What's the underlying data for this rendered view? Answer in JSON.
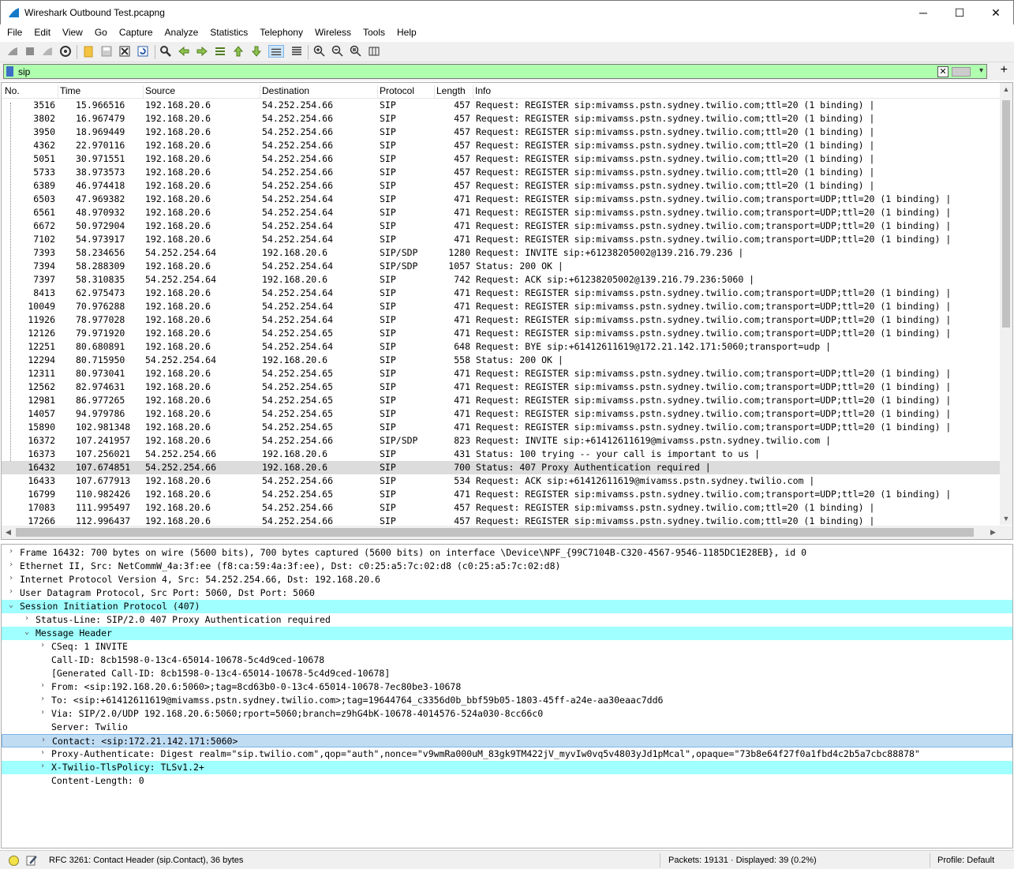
{
  "window": {
    "title": "Wireshark Outbound Test.pcapng",
    "minimize": "─",
    "maximize": "☐",
    "close": "✕"
  },
  "menu": [
    "File",
    "Edit",
    "View",
    "Go",
    "Capture",
    "Analyze",
    "Statistics",
    "Telephony",
    "Wireless",
    "Tools",
    "Help"
  ],
  "filter": {
    "value": "sip",
    "clear": "✕",
    "dropdown": "▾",
    "add": "+"
  },
  "columns": {
    "no": "No.",
    "time": "Time",
    "source": "Source",
    "destination": "Destination",
    "protocol": "Protocol",
    "length": "Length",
    "info": "Info"
  },
  "packets": [
    {
      "no": "3516",
      "time": "15.966516",
      "src": "192.168.20.6",
      "dst": "54.252.254.66",
      "proto": "SIP",
      "len": "457",
      "info": "Request: REGISTER sip:mivamss.pstn.sydney.twilio.com;ttl=20  (1 binding) |"
    },
    {
      "no": "3802",
      "time": "16.967479",
      "src": "192.168.20.6",
      "dst": "54.252.254.66",
      "proto": "SIP",
      "len": "457",
      "info": "Request: REGISTER sip:mivamss.pstn.sydney.twilio.com;ttl=20  (1 binding) |"
    },
    {
      "no": "3950",
      "time": "18.969449",
      "src": "192.168.20.6",
      "dst": "54.252.254.66",
      "proto": "SIP",
      "len": "457",
      "info": "Request: REGISTER sip:mivamss.pstn.sydney.twilio.com;ttl=20  (1 binding) |"
    },
    {
      "no": "4362",
      "time": "22.970116",
      "src": "192.168.20.6",
      "dst": "54.252.254.66",
      "proto": "SIP",
      "len": "457",
      "info": "Request: REGISTER sip:mivamss.pstn.sydney.twilio.com;ttl=20  (1 binding) |"
    },
    {
      "no": "5051",
      "time": "30.971551",
      "src": "192.168.20.6",
      "dst": "54.252.254.66",
      "proto": "SIP",
      "len": "457",
      "info": "Request: REGISTER sip:mivamss.pstn.sydney.twilio.com;ttl=20  (1 binding) |"
    },
    {
      "no": "5733",
      "time": "38.973573",
      "src": "192.168.20.6",
      "dst": "54.252.254.66",
      "proto": "SIP",
      "len": "457",
      "info": "Request: REGISTER sip:mivamss.pstn.sydney.twilio.com;ttl=20  (1 binding) |"
    },
    {
      "no": "6389",
      "time": "46.974418",
      "src": "192.168.20.6",
      "dst": "54.252.254.66",
      "proto": "SIP",
      "len": "457",
      "info": "Request: REGISTER sip:mivamss.pstn.sydney.twilio.com;ttl=20  (1 binding) |"
    },
    {
      "no": "6503",
      "time": "47.969382",
      "src": "192.168.20.6",
      "dst": "54.252.254.64",
      "proto": "SIP",
      "len": "471",
      "info": "Request: REGISTER sip:mivamss.pstn.sydney.twilio.com;transport=UDP;ttl=20  (1 binding) |"
    },
    {
      "no": "6561",
      "time": "48.970932",
      "src": "192.168.20.6",
      "dst": "54.252.254.64",
      "proto": "SIP",
      "len": "471",
      "info": "Request: REGISTER sip:mivamss.pstn.sydney.twilio.com;transport=UDP;ttl=20  (1 binding) |"
    },
    {
      "no": "6672",
      "time": "50.972904",
      "src": "192.168.20.6",
      "dst": "54.252.254.64",
      "proto": "SIP",
      "len": "471",
      "info": "Request: REGISTER sip:mivamss.pstn.sydney.twilio.com;transport=UDP;ttl=20  (1 binding) |"
    },
    {
      "no": "7102",
      "time": "54.973917",
      "src": "192.168.20.6",
      "dst": "54.252.254.64",
      "proto": "SIP",
      "len": "471",
      "info": "Request: REGISTER sip:mivamss.pstn.sydney.twilio.com;transport=UDP;ttl=20  (1 binding) |"
    },
    {
      "no": "7393",
      "time": "58.234656",
      "src": "54.252.254.64",
      "dst": "192.168.20.6",
      "proto": "SIP/SDP",
      "len": "1280",
      "info": "Request: INVITE sip:+61238205002@139.216.79.236 |"
    },
    {
      "no": "7394",
      "time": "58.288309",
      "src": "192.168.20.6",
      "dst": "54.252.254.64",
      "proto": "SIP/SDP",
      "len": "1057",
      "info": "Status: 200 OK |"
    },
    {
      "no": "7397",
      "time": "58.310835",
      "src": "54.252.254.64",
      "dst": "192.168.20.6",
      "proto": "SIP",
      "len": "742",
      "info": "Request: ACK sip:+61238205002@139.216.79.236:5060 |"
    },
    {
      "no": "8413",
      "time": "62.975473",
      "src": "192.168.20.6",
      "dst": "54.252.254.64",
      "proto": "SIP",
      "len": "471",
      "info": "Request: REGISTER sip:mivamss.pstn.sydney.twilio.com;transport=UDP;ttl=20  (1 binding) |"
    },
    {
      "no": "10049",
      "time": "70.976288",
      "src": "192.168.20.6",
      "dst": "54.252.254.64",
      "proto": "SIP",
      "len": "471",
      "info": "Request: REGISTER sip:mivamss.pstn.sydney.twilio.com;transport=UDP;ttl=20  (1 binding) |"
    },
    {
      "no": "11926",
      "time": "78.977028",
      "src": "192.168.20.6",
      "dst": "54.252.254.64",
      "proto": "SIP",
      "len": "471",
      "info": "Request: REGISTER sip:mivamss.pstn.sydney.twilio.com;transport=UDP;ttl=20  (1 binding) |"
    },
    {
      "no": "12126",
      "time": "79.971920",
      "src": "192.168.20.6",
      "dst": "54.252.254.65",
      "proto": "SIP",
      "len": "471",
      "info": "Request: REGISTER sip:mivamss.pstn.sydney.twilio.com;transport=UDP;ttl=20  (1 binding) |"
    },
    {
      "no": "12251",
      "time": "80.680891",
      "src": "192.168.20.6",
      "dst": "54.252.254.64",
      "proto": "SIP",
      "len": "648",
      "info": "Request: BYE sip:+61412611619@172.21.142.171:5060;transport=udp |"
    },
    {
      "no": "12294",
      "time": "80.715950",
      "src": "54.252.254.64",
      "dst": "192.168.20.6",
      "proto": "SIP",
      "len": "558",
      "info": "Status: 200 OK |"
    },
    {
      "no": "12311",
      "time": "80.973041",
      "src": "192.168.20.6",
      "dst": "54.252.254.65",
      "proto": "SIP",
      "len": "471",
      "info": "Request: REGISTER sip:mivamss.pstn.sydney.twilio.com;transport=UDP;ttl=20  (1 binding) |"
    },
    {
      "no": "12562",
      "time": "82.974631",
      "src": "192.168.20.6",
      "dst": "54.252.254.65",
      "proto": "SIP",
      "len": "471",
      "info": "Request: REGISTER sip:mivamss.pstn.sydney.twilio.com;transport=UDP;ttl=20  (1 binding) |"
    },
    {
      "no": "12981",
      "time": "86.977265",
      "src": "192.168.20.6",
      "dst": "54.252.254.65",
      "proto": "SIP",
      "len": "471",
      "info": "Request: REGISTER sip:mivamss.pstn.sydney.twilio.com;transport=UDP;ttl=20  (1 binding) |"
    },
    {
      "no": "14057",
      "time": "94.979786",
      "src": "192.168.20.6",
      "dst": "54.252.254.65",
      "proto": "SIP",
      "len": "471",
      "info": "Request: REGISTER sip:mivamss.pstn.sydney.twilio.com;transport=UDP;ttl=20  (1 binding) |"
    },
    {
      "no": "15890",
      "time": "102.981348",
      "src": "192.168.20.6",
      "dst": "54.252.254.65",
      "proto": "SIP",
      "len": "471",
      "info": "Request: REGISTER sip:mivamss.pstn.sydney.twilio.com;transport=UDP;ttl=20  (1 binding) |"
    },
    {
      "no": "16372",
      "time": "107.241957",
      "src": "192.168.20.6",
      "dst": "54.252.254.66",
      "proto": "SIP/SDP",
      "len": "823",
      "info": "Request: INVITE sip:+61412611619@mivamss.pstn.sydney.twilio.com |"
    },
    {
      "no": "16373",
      "time": "107.256021",
      "src": "54.252.254.66",
      "dst": "192.168.20.6",
      "proto": "SIP",
      "len": "431",
      "info": "Status: 100 trying -- your call is important to us |"
    },
    {
      "no": "16432",
      "time": "107.674851",
      "src": "54.252.254.66",
      "dst": "192.168.20.6",
      "proto": "SIP",
      "len": "700",
      "info": "Status: 407 Proxy Authentication required |",
      "selected": true
    },
    {
      "no": "16433",
      "time": "107.677913",
      "src": "192.168.20.6",
      "dst": "54.252.254.66",
      "proto": "SIP",
      "len": "534",
      "info": "Request: ACK sip:+61412611619@mivamss.pstn.sydney.twilio.com |"
    },
    {
      "no": "16799",
      "time": "110.982426",
      "src": "192.168.20.6",
      "dst": "54.252.254.65",
      "proto": "SIP",
      "len": "471",
      "info": "Request: REGISTER sip:mivamss.pstn.sydney.twilio.com;transport=UDP;ttl=20  (1 binding) |"
    },
    {
      "no": "17083",
      "time": "111.995497",
      "src": "192.168.20.6",
      "dst": "54.252.254.66",
      "proto": "SIP",
      "len": "457",
      "info": "Request: REGISTER sip:mivamss.pstn.sydney.twilio.com;ttl=20  (1 binding) |"
    },
    {
      "no": "17266",
      "time": "112.996437",
      "src": "192.168.20.6",
      "dst": "54.252.254.66",
      "proto": "SIP",
      "len": "457",
      "info": "Request: REGISTER sip:mivamss.pstn.sydney.twilio.com;ttl=20  (1 binding) |"
    }
  ],
  "details": [
    {
      "level": 0,
      "arrow": "right",
      "text": "Frame 16432: 700 bytes on wire (5600 bits), 700 bytes captured (5600 bits) on interface \\Device\\NPF_{99C7104B-C320-4567-9546-1185DC1E28EB}, id 0"
    },
    {
      "level": 0,
      "arrow": "right",
      "text": "Ethernet II, Src: NetCommW_4a:3f:ee (f8:ca:59:4a:3f:ee), Dst: c0:25:a5:7c:02:d8 (c0:25:a5:7c:02:d8)"
    },
    {
      "level": 0,
      "arrow": "right",
      "text": "Internet Protocol Version 4, Src: 54.252.254.66, Dst: 192.168.20.6"
    },
    {
      "level": 0,
      "arrow": "right",
      "text": "User Datagram Protocol, Src Port: 5060, Dst Port: 5060"
    },
    {
      "level": 0,
      "arrow": "down",
      "text": "Session Initiation Protocol (407)",
      "hl": true
    },
    {
      "level": 1,
      "arrow": "right",
      "text": "Status-Line: SIP/2.0 407 Proxy Authentication required"
    },
    {
      "level": 1,
      "arrow": "down",
      "text": "Message Header",
      "hl": true
    },
    {
      "level": 2,
      "arrow": "right",
      "text": "CSeq: 1 INVITE"
    },
    {
      "level": 2,
      "arrow": "",
      "text": "Call-ID: 8cb1598-0-13c4-65014-10678-5c4d9ced-10678"
    },
    {
      "level": 2,
      "arrow": "",
      "text": "[Generated Call-ID: 8cb1598-0-13c4-65014-10678-5c4d9ced-10678]"
    },
    {
      "level": 2,
      "arrow": "right",
      "text": "From: <sip:192.168.20.6:5060>;tag=8cd63b0-0-13c4-65014-10678-7ec80be3-10678"
    },
    {
      "level": 2,
      "arrow": "right",
      "text": "To: <sip:+61412611619@mivamss.pstn.sydney.twilio.com>;tag=19644764_c3356d0b_bbf59b05-1803-45ff-a24e-aa30eaac7dd6"
    },
    {
      "level": 2,
      "arrow": "right",
      "text": "Via: SIP/2.0/UDP 192.168.20.6:5060;rport=5060;branch=z9hG4bK-10678-4014576-524a030-8cc66c0"
    },
    {
      "level": 2,
      "arrow": "",
      "text": "Server: Twilio"
    },
    {
      "level": 2,
      "arrow": "right",
      "text": "Contact: <sip:172.21.142.171:5060>",
      "sel": true
    },
    {
      "level": 2,
      "arrow": "right",
      "text": "Proxy-Authenticate: Digest realm=\"sip.twilio.com\",qop=\"auth\",nonce=\"v9wmRa000uM_83gk9TM422jV_myvIw0vq5v4803yJd1pMcal\",opaque=\"73b8e64f27f0a1fbd4c2b5a7cbc88878\""
    },
    {
      "level": 2,
      "arrow": "right",
      "text": "X-Twilio-TlsPolicy: TLSv1.2+",
      "hl": true
    },
    {
      "level": 2,
      "arrow": "",
      "text": "Content-Length: 0"
    }
  ],
  "status": {
    "field": "RFC 3261: Contact Header (sip.Contact), 36 bytes",
    "packets": "Packets: 19131 · Displayed: 39 (0.2%)",
    "profile": "Profile: Default"
  }
}
